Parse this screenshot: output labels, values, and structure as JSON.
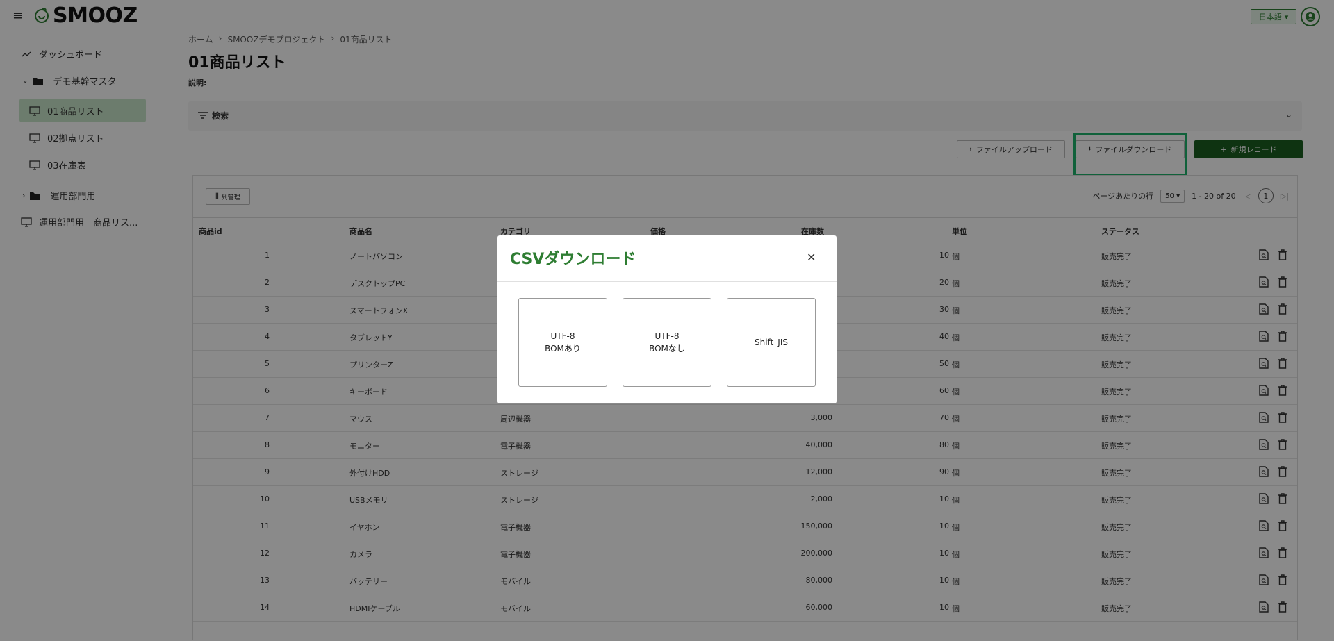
{
  "header": {
    "logo_text": "SMOOZ",
    "language": "日本語"
  },
  "sidebar": {
    "items": [
      {
        "label": "ダッシュボード"
      },
      {
        "label": "デモ基幹マスタ"
      },
      {
        "label": "01商品リスト"
      },
      {
        "label": "02拠点リスト"
      },
      {
        "label": "03在庫表"
      },
      {
        "label": "運用部門用"
      },
      {
        "label": "運用部門用　商品リス..."
      }
    ]
  },
  "breadcrumb": {
    "home": "ホーム",
    "project": "SMOOZデモプロジェクト",
    "current": "01商品リスト"
  },
  "page": {
    "title": "01商品リスト",
    "description": "説明:",
    "search_label": "検索"
  },
  "toolbar": {
    "upload_label": "ファイルアップロード",
    "download_label": "ファイルダウンロード",
    "new_label": "新規レコード"
  },
  "table": {
    "column_manage_label": "列管理",
    "rows_per_page_label": "ページあたりの行",
    "rows_per_page": "50",
    "range": "1 - 20 of 20",
    "page": "1",
    "headers": {
      "id": "商品id",
      "name": "商品名",
      "category": "カテゴリ",
      "price": "価格",
      "stock": "在庫数",
      "unit": "単位",
      "status": "ステータス"
    },
    "rows": [
      {
        "id": "1",
        "name": "ノートパソコン",
        "category": "",
        "price": "",
        "stock": "10",
        "unit": "個",
        "status": "販売完了"
      },
      {
        "id": "2",
        "name": "デスクトップPC",
        "category": "",
        "price": "",
        "stock": "20",
        "unit": "個",
        "status": "販売完了"
      },
      {
        "id": "3",
        "name": "スマートフォンX",
        "category": "",
        "price": "",
        "stock": "30",
        "unit": "個",
        "status": "販売完了"
      },
      {
        "id": "4",
        "name": "タブレットY",
        "category": "",
        "price": "",
        "stock": "40",
        "unit": "個",
        "status": "販売完了"
      },
      {
        "id": "5",
        "name": "プリンターZ",
        "category": "",
        "price": "",
        "stock": "50",
        "unit": "個",
        "status": "販売完了"
      },
      {
        "id": "6",
        "name": "キーボード",
        "category": "",
        "price": "",
        "stock": "60",
        "unit": "個",
        "status": "販売完了"
      },
      {
        "id": "7",
        "name": "マウス",
        "category": "周辺機器",
        "price": "3,000",
        "stock": "70",
        "unit": "個",
        "status": "販売完了"
      },
      {
        "id": "8",
        "name": "モニター",
        "category": "電子機器",
        "price": "40,000",
        "stock": "80",
        "unit": "個",
        "status": "販売完了"
      },
      {
        "id": "9",
        "name": "外付けHDD",
        "category": "ストレージ",
        "price": "12,000",
        "stock": "90",
        "unit": "個",
        "status": "販売完了"
      },
      {
        "id": "10",
        "name": "USBメモリ",
        "category": "ストレージ",
        "price": "2,000",
        "stock": "10",
        "unit": "個",
        "status": "販売完了"
      },
      {
        "id": "11",
        "name": "イヤホン",
        "category": "電子機器",
        "price": "150,000",
        "stock": "10",
        "unit": "個",
        "status": "販売完了"
      },
      {
        "id": "12",
        "name": "カメラ",
        "category": "電子機器",
        "price": "200,000",
        "stock": "10",
        "unit": "個",
        "status": "販売完了"
      },
      {
        "id": "13",
        "name": "バッテリー",
        "category": "モバイル",
        "price": "80,000",
        "stock": "10",
        "unit": "個",
        "status": "販売完了"
      },
      {
        "id": "14",
        "name": "HDMIケーブル",
        "category": "モバイル",
        "price": "60,000",
        "stock": "10",
        "unit": "個",
        "status": "販売完了"
      }
    ]
  },
  "modal": {
    "title": "CSVダウンロード",
    "options": [
      {
        "line1": "UTF-8",
        "line2": "BOMあり"
      },
      {
        "line1": "UTF-8",
        "line2": "BOMなし"
      },
      {
        "line1": "Shift_JIS",
        "line2": ""
      }
    ]
  },
  "colors": {
    "accent": "#2e7d32",
    "highlight": "#1eb36b",
    "primary_button": "#1b5e20"
  }
}
